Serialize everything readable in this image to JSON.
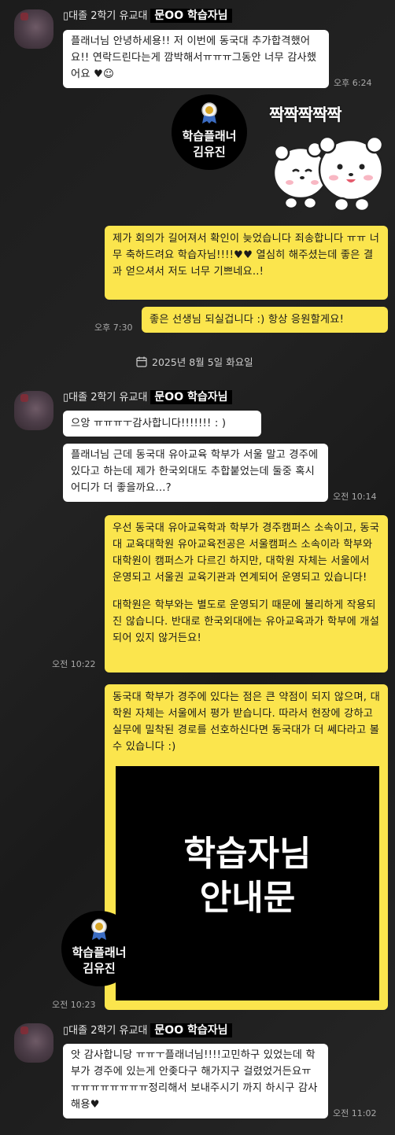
{
  "messages": {
    "m1": {
      "sender": "▯대졸 2학기 유교대",
      "sender_tag": "문OO 학습자님",
      "text": "플래너님 안녕하세용!! 저 이번에 동국대 추가합격했어요!! 연락드린다는게 깜박해서ㅠㅠㅠ그동안 너무 감사했어요 ♥☺",
      "time": "오후 6:24"
    },
    "planner_badge": {
      "line1": "학습플래너",
      "line2": "김유진"
    },
    "sticker_caption": "짝짝짝짝짝",
    "m2": {
      "text": "제가 회의가 길어져서 확인이 늦었습니다 죄송합니다 ㅠㅠ 너무 축하드려요 학습자님!!!!♥♥ 열심히 해주셨는데 좋은 결과 얻으셔서 저도 너무 기쁘네요..!"
    },
    "m3": {
      "text": "좋은 선생님 되실겁니다 :) 항상 응원할게요!",
      "time": "오후 7:30"
    },
    "date_separator": "2025년 8월 5일 화요일",
    "m4": {
      "sender": "▯대졸 2학기 유교대",
      "sender_tag": "문OO 학습자님",
      "text": "으앙 ㅠㅠㅠㅜ감사합니다!!!!!!!  :  )"
    },
    "m5": {
      "text": "플래너님 근데 동국대 유아교육 학부가 서울 말고 경주에 있다고 하는데 제가 한국외대도 추합붙었는데 둘중 혹시 어디가 더 좋을까요...?",
      "time": "오전 10:14"
    },
    "m6": {
      "para1": "우선 동국대 유아교육학과 학부가 경주캠퍼스 소속이고, 동국대 교육대학원 유아교육전공은 서울캠퍼스 소속이라 학부와 대학원이 캠퍼스가 다르긴 하지만, 대학원 자체는 서울에서 운영되고 서울권 교육기관과 연계되어 운영되고 있습니다!",
      "para2": "대학원은 학부와는 별도로 운영되기 때문에 불리하게 작용되진 않습니다. 반대로 한국외대에는 유아교육과가 학부에 개설되어 있지 않거든요!",
      "time": "오전 10:22"
    },
    "m7": {
      "text": "동국대 학부가 경주에 있다는 점은 큰 약점이 되지 않으며, 대학원 자체는 서울에서 평가 받습니다. 따라서 현장에 강하고 실무에 밀착된 경로를 선호하신다면 동국대가 더 쎄다라고 볼 수 있습니다 :)",
      "notice_line1": "학습자님",
      "notice_line2": "안내문",
      "time": "오전 10:23"
    },
    "m8": {
      "sender": "▯대졸 2학기 유교대",
      "sender_tag": "문OO 학습자님",
      "text": "앗 감사합니당 ㅠㅠㅜ플래너님!!!!고민하구 있었는데 학부가 경주에 있는게 안좆다구 해가지구 걸렸었거든요ㅠㅠㅠㅠㅠㅠㅠㅠㅠ정리해서 보내주시기 까지 하시구 감사해용♥",
      "time": "오전 11:02"
    }
  }
}
